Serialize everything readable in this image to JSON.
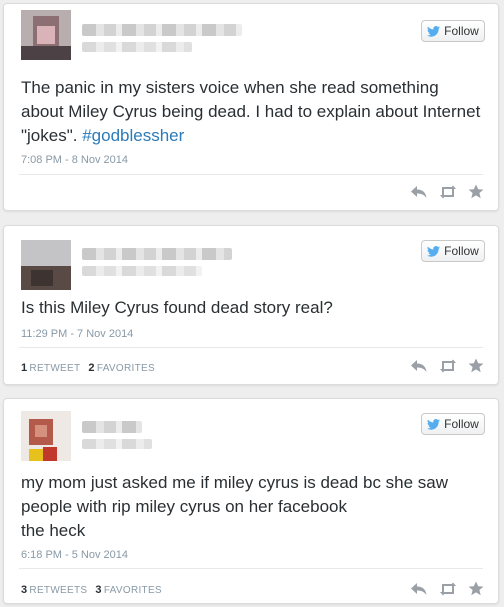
{
  "follow_label": "Follow",
  "tweets": [
    {
      "text_before": "The panic in my sisters voice when she read something about Miley Cyrus being dead. I had to explain about Internet \"jokes\". ",
      "hashtag": "#godblessher",
      "timestamp": "7:08 PM - 8 Nov 2014"
    },
    {
      "text": "Is this Miley Cyrus found dead story real?",
      "timestamp": "11:29 PM - 7 Nov 2014",
      "retweet_count": "1",
      "retweet_label": "Retweet",
      "favorite_count": "2",
      "favorite_label": "Favorites"
    },
    {
      "text_line1": "my mom just asked me if miley cyrus is dead bc she saw",
      "text_line2": "people with rip miley cyrus on her facebook",
      "text_line3": "the heck",
      "timestamp": "6:18 PM - 5 Nov 2014",
      "retweet_count": "3",
      "retweet_label": "Retweets",
      "favorite_count": "3",
      "favorite_label": "Favorites"
    }
  ],
  "colors": {
    "link": "#2b7bb9",
    "bird": "#55acee",
    "icon": "#9aa0a6"
  },
  "icons": [
    "twitter-bird-icon",
    "reply-icon",
    "retweet-icon",
    "favorite-star-icon"
  ]
}
